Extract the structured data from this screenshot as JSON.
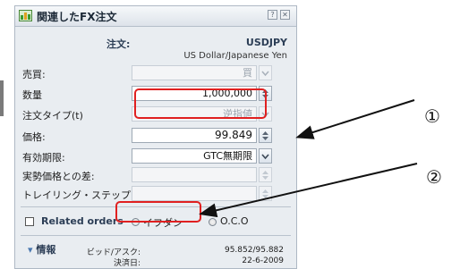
{
  "window": {
    "title": "関連したFX注文"
  },
  "order": {
    "label": "注文:",
    "symbol": "USDJPY",
    "symbol_name": "US Dollar/Japanese Yen"
  },
  "fields": {
    "buy_sell": {
      "label": "売買:",
      "value": "買"
    },
    "quantity": {
      "label": "数量",
      "value": "1,000,000"
    },
    "order_type": {
      "label": "注文タイプ(t)",
      "value": "逆指値"
    },
    "price": {
      "label": "価格:",
      "value": "99.849"
    },
    "expiry": {
      "label": "有効期限:",
      "value": "GTC無期限"
    },
    "diff": {
      "label": "実勢価格との差:",
      "value": ""
    },
    "trailing": {
      "label": "トレイリング・ステップ:",
      "value": ""
    }
  },
  "related": {
    "label": "Related orders",
    "option1": "イフダン",
    "option2": "O.C.O"
  },
  "info": {
    "heading": "情報",
    "bid_ask_label": "ビッド/アスク:",
    "bid_ask_value": "95.852/95.882",
    "settle_label": "決済日:",
    "settle_value": "22-6-2009"
  },
  "annotations": {
    "circle1": "①",
    "circle2": "②"
  },
  "colors": {
    "highlight": "#e02020",
    "accent": "#2c3e56",
    "panel": "#e9edf1"
  }
}
